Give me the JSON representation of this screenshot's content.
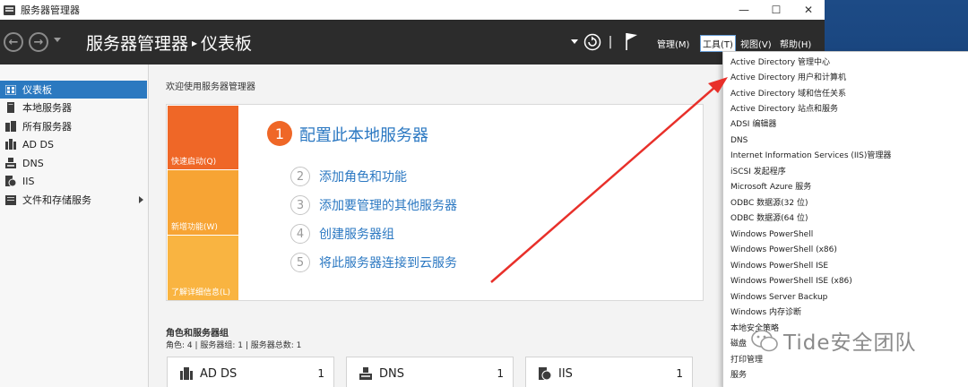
{
  "window": {
    "title": "服务器管理器",
    "controls": {
      "minimize": "—",
      "maximize": "☐",
      "close": "✕"
    }
  },
  "header": {
    "back_icon": "back-arrow-icon",
    "forward_icon": "forward-arrow-icon",
    "title": "服务器管理器",
    "separator": "▸",
    "subtitle": "仪表板",
    "menu": {
      "manage": "管理(M)",
      "tools": "工具(T)",
      "view": "视图(V)",
      "help": "帮助(H)"
    }
  },
  "sidebar": {
    "items": [
      {
        "label": "仪表板",
        "icon": "dashboard-icon",
        "selected": true
      },
      {
        "label": "本地服务器",
        "icon": "server-icon"
      },
      {
        "label": "所有服务器",
        "icon": "servers-icon"
      },
      {
        "label": "AD DS",
        "icon": "ad-ds-icon"
      },
      {
        "label": "DNS",
        "icon": "dns-icon"
      },
      {
        "label": "IIS",
        "icon": "iis-icon"
      },
      {
        "label": "文件和存储服务",
        "icon": "file-storage-icon",
        "has_submenu": true
      }
    ]
  },
  "main": {
    "welcome_title": "欢迎使用服务器管理器",
    "tiles": [
      {
        "label": "快速启动(Q)",
        "color": "#ef6727"
      },
      {
        "label": "新增功能(W)",
        "color": "#f7a434"
      },
      {
        "label": "了解详细信息(L)",
        "color": "#f9b441"
      }
    ],
    "steps": [
      {
        "num": "1",
        "text": "配置此本地服务器"
      },
      {
        "num": "2",
        "text": "添加角色和功能"
      },
      {
        "num": "3",
        "text": "添加要管理的其他服务器"
      },
      {
        "num": "4",
        "text": "创建服务器组"
      },
      {
        "num": "5",
        "text": "将此服务器连接到云服务"
      }
    ],
    "roles_title": "角色和服务器组",
    "roles_counts": "角色: 4 | 服务器组: 1 | 服务器总数: 1",
    "role_cards": [
      {
        "name": "AD DS",
        "count": "1",
        "icon": "ad-ds-icon"
      },
      {
        "name": "DNS",
        "count": "1",
        "icon": "dns-icon"
      },
      {
        "name": "IIS",
        "count": "1",
        "icon": "iis-icon"
      }
    ]
  },
  "tools_menu": {
    "items": [
      "Active Directory 管理中心",
      "Active Directory 用户和计算机",
      "Active Directory 域和信任关系",
      "Active Directory 站点和服务",
      "ADSI 编辑器",
      "DNS",
      "Internet Information Services (IIS)管理器",
      "iSCSI 发起程序",
      "Microsoft Azure 服务",
      "ODBC 数据源(32 位)",
      "ODBC 数据源(64 位)",
      "Windows PowerShell",
      "Windows PowerShell (x86)",
      "Windows PowerShell ISE",
      "Windows PowerShell ISE (x86)",
      "Windows Server Backup",
      "Windows 内存诊断",
      "本地安全策略",
      "磁盘",
      "打印管理",
      "服务"
    ]
  },
  "watermark": {
    "text": "Tide安全团队",
    "icon": "wechat-logo-icon"
  },
  "colors": {
    "accent_blue": "#2b79c0",
    "header_bg": "#2c2c2c",
    "tile_orange": "#ef6727",
    "link_blue": "#2b78c2",
    "annotation_red": "#e8302a"
  }
}
